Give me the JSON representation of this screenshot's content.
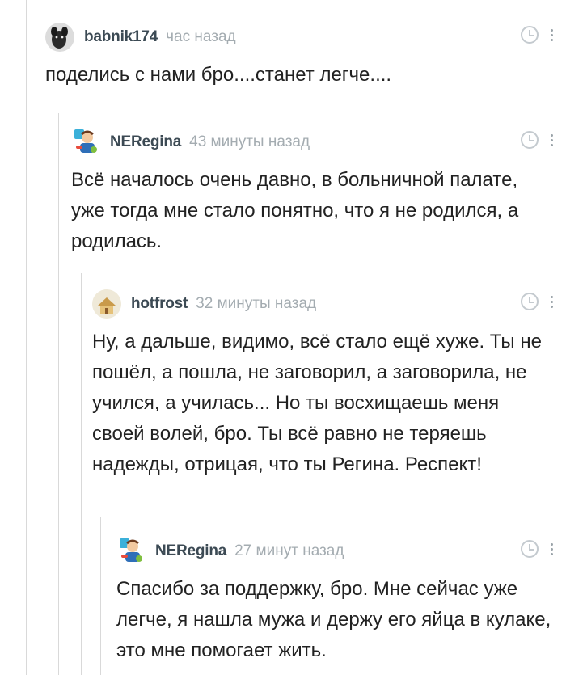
{
  "comments": [
    {
      "author": "babnik174",
      "time": "час назад",
      "text": "поделись с нами бро....станет легче...."
    },
    {
      "author": "NERegina",
      "time": "43 минуты назад",
      "text": "Всё началось очень давно, в больничной палате, уже тогда мне стало понятно, что я не родился, а родилась."
    },
    {
      "author": "hotfrost",
      "time": "32 минуты назад",
      "text": "Ну, а дальше, видимо, всё стало ещё хуже. Ты не пошёл, а пошла, не заговорил, а заговорила, не учился, а училась... Но ты восхищаешь меня своей волей, бро. Ты всё равно не теряешь надежды, отрицая, что ты Регина. Респект!"
    },
    {
      "author": "NERegina",
      "time": "27 минут назад",
      "text": "Спасибо за поддержку, бро. Мне сейчас уже легче, я нашла мужа и держу его яйца в кулаке, это мне помогает жить."
    }
  ],
  "colors": {
    "author": "#3c4a54",
    "time": "#a4acb1",
    "text": "#222222",
    "thread_line": "#d9d9d9"
  },
  "icons": [
    "clock-icon",
    "more-options-icon"
  ]
}
